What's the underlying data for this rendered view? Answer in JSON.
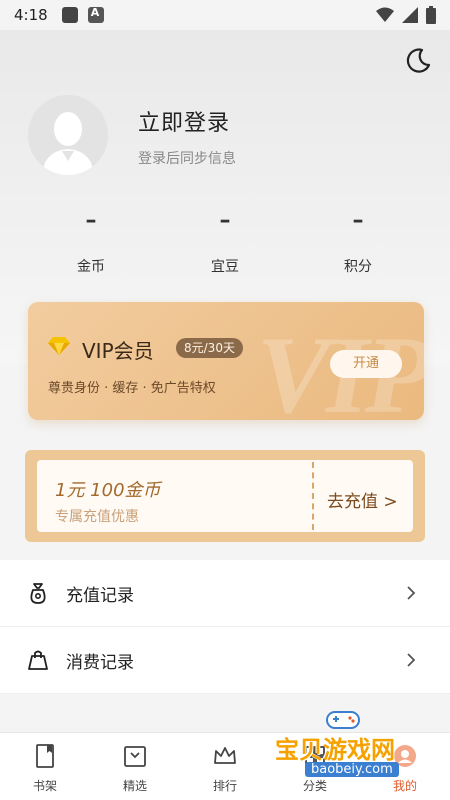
{
  "status_bar": {
    "time": "4:18"
  },
  "header": {
    "login_title": "立即登录",
    "login_subtitle": "登录后同步信息"
  },
  "stats": [
    {
      "value": "–",
      "label": "金币"
    },
    {
      "value": "–",
      "label": "宜豆"
    },
    {
      "value": "–",
      "label": "积分"
    }
  ],
  "vip": {
    "title": "VIP会员",
    "price": "8元/30天",
    "desc": "尊贵身份 · 缓存 · 免广告特权",
    "button": "开通",
    "watermark": "VIP"
  },
  "recharge": {
    "amount": "1元 100金币",
    "desc": "专属充值优惠",
    "button": "去充值 >"
  },
  "list": [
    {
      "label": "充值记录",
      "icon": "money-bag-icon"
    },
    {
      "label": "消费记录",
      "icon": "shopping-bag-icon"
    }
  ],
  "nav": [
    {
      "label": "书架",
      "icon": "bookshelf-icon"
    },
    {
      "label": "精选",
      "icon": "featured-icon"
    },
    {
      "label": "排行",
      "icon": "crown-icon"
    },
    {
      "label": "分类",
      "icon": "category-icon"
    },
    {
      "label": "我的",
      "icon": "profile-icon"
    }
  ],
  "watermark": {
    "text": "宝贝游戏网",
    "url": "baobeiy.com"
  },
  "colors": {
    "accent": "#e05a2a",
    "vip_gold": "#eab97f",
    "recharge_gold": "#edc796"
  }
}
